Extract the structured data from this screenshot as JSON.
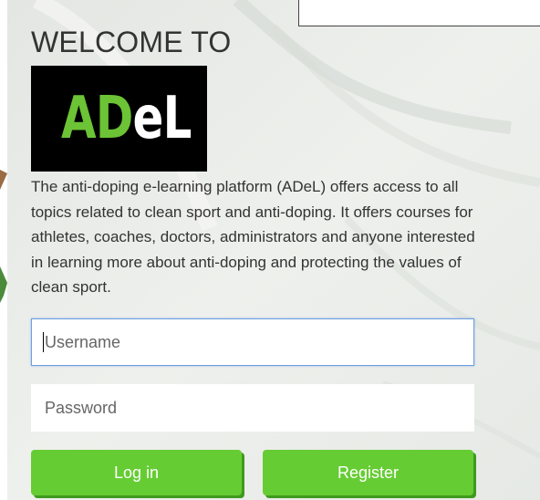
{
  "welcome": {
    "heading": "WELCOME TO",
    "logo_text_green": "AD",
    "logo_text_white": "eL"
  },
  "description": "The anti-doping e-learning platform (ADeL) offers access to all topics related to clean sport and anti-doping. It offers courses for athletes, coaches, doctors, administrators and anyone interested in learning more about anti-doping and protecting the values of clean sport.",
  "login_form": {
    "username_placeholder": "Username",
    "password_placeholder": "Password",
    "login_label": "Log in",
    "register_label": "Register"
  },
  "colors": {
    "button_green": "#66cc33",
    "logo_green": "#6cc335",
    "text": "#333333"
  }
}
